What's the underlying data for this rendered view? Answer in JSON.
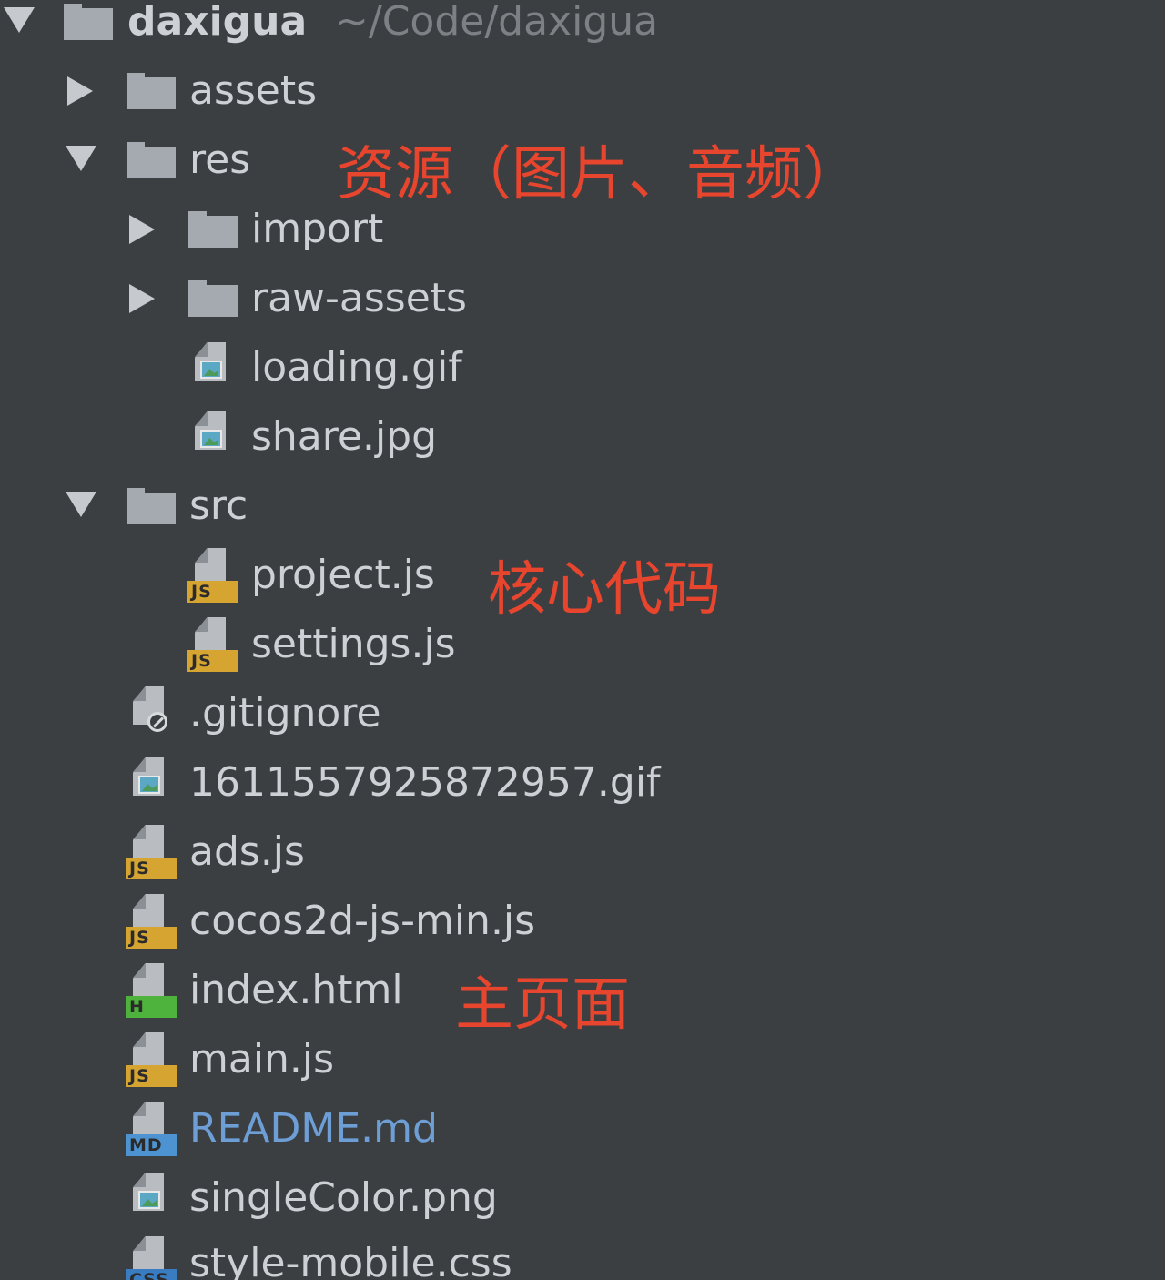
{
  "root": {
    "name": "daxigua",
    "path": "~/Code/daxigua"
  },
  "colors": {
    "js": "#d6a531",
    "html": "#4eb33c",
    "md": "#4d93d1",
    "css": "#3a7cc2",
    "annotation": "#e8452f"
  },
  "items": [
    {
      "name": "assets",
      "kind": "folder",
      "state": "collapsed"
    },
    {
      "name": "res",
      "kind": "folder",
      "state": "expanded"
    },
    {
      "name": "import",
      "kind": "folder",
      "state": "collapsed"
    },
    {
      "name": "raw-assets",
      "kind": "folder",
      "state": "collapsed"
    },
    {
      "name": "loading.gif",
      "kind": "image",
      "icon": "image-file-icon"
    },
    {
      "name": "share.jpg",
      "kind": "image",
      "icon": "image-file-icon"
    },
    {
      "name": "src",
      "kind": "folder",
      "state": "expanded"
    },
    {
      "name": "project.js",
      "kind": "js",
      "badge": "JS"
    },
    {
      "name": "settings.js",
      "kind": "js",
      "badge": "JS"
    },
    {
      "name": ".gitignore",
      "kind": "ignore",
      "icon": "gitignore-file-icon"
    },
    {
      "name": "1611557925872957.gif",
      "kind": "image",
      "icon": "image-file-icon"
    },
    {
      "name": "ads.js",
      "kind": "js",
      "badge": "JS"
    },
    {
      "name": "cocos2d-js-min.js",
      "kind": "js",
      "badge": "JS"
    },
    {
      "name": "index.html",
      "kind": "html",
      "badge": "H"
    },
    {
      "name": "main.js",
      "kind": "js",
      "badge": "JS"
    },
    {
      "name": "README.md",
      "kind": "md",
      "badge": "MD"
    },
    {
      "name": "singleColor.png",
      "kind": "image",
      "icon": "image-file-icon"
    },
    {
      "name": "style-mobile.css",
      "kind": "css",
      "badge": "CSS"
    }
  ],
  "annotations": {
    "res": "资源（图片、音频）",
    "src": "核心代码",
    "index": "主页面"
  }
}
